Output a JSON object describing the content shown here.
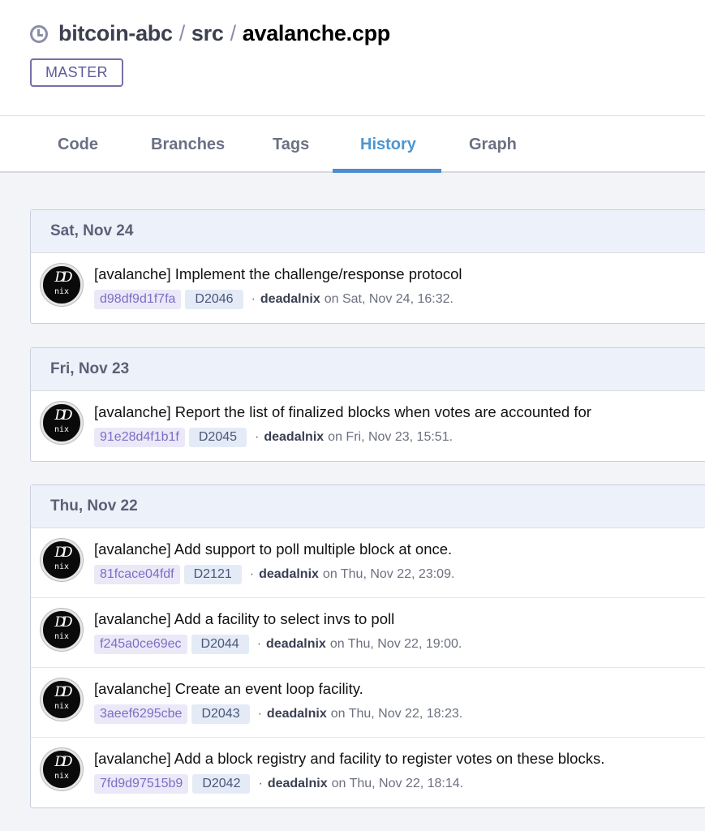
{
  "header": {
    "breadcrumbs": [
      "bitcoin-abc",
      "src",
      "avalanche.cpp"
    ],
    "separator": "/",
    "branch_label": "MASTER"
  },
  "tabs": [
    {
      "label": "Code",
      "active": false
    },
    {
      "label": "Branches",
      "active": false
    },
    {
      "label": "Tags",
      "active": false
    },
    {
      "label": "History",
      "active": true
    },
    {
      "label": "Graph",
      "active": false
    }
  ],
  "groups": [
    {
      "date": "Sat, Nov 24",
      "commits": [
        {
          "message": "[avalanche] Implement the challenge/response protocol",
          "hash": "d98df9d1f7fa",
          "revision": "D2046",
          "author": "deadalnix",
          "when": "on Sat, Nov 24, 16:32."
        }
      ]
    },
    {
      "date": "Fri, Nov 23",
      "commits": [
        {
          "message": "[avalanche] Report the list of finalized blocks when votes are accounted for",
          "hash": "91e28d4f1b1f",
          "revision": "D2045",
          "author": "deadalnix",
          "when": "on Fri, Nov 23, 15:51."
        }
      ]
    },
    {
      "date": "Thu, Nov 22",
      "commits": [
        {
          "message": "[avalanche] Add support to poll multiple block at once.",
          "hash": "81fcace04fdf",
          "revision": "D2121",
          "author": "deadalnix",
          "when": "on Thu, Nov 22, 23:09."
        },
        {
          "message": "[avalanche] Add a facility to select invs to poll",
          "hash": "f245a0ce69ec",
          "revision": "D2044",
          "author": "deadalnix",
          "when": "on Thu, Nov 22, 19:00."
        },
        {
          "message": "[avalanche] Create an event loop facility.",
          "hash": "3aeef6295cbe",
          "revision": "D2043",
          "author": "deadalnix",
          "when": "on Thu, Nov 22, 18:23."
        },
        {
          "message": "[avalanche] Add a block registry and facility to register votes on these blocks.",
          "hash": "7fd9d97515b9",
          "revision": "D2042",
          "author": "deadalnix",
          "when": "on Thu, Nov 22, 18:14."
        }
      ]
    }
  ],
  "avatar": {
    "top": "DD",
    "bottom": "nix"
  },
  "meta_dot": "·",
  "colors": {
    "accent": "#4d8ccd",
    "hash_text": "#7b6fc4",
    "branch_border": "#7470a8"
  }
}
